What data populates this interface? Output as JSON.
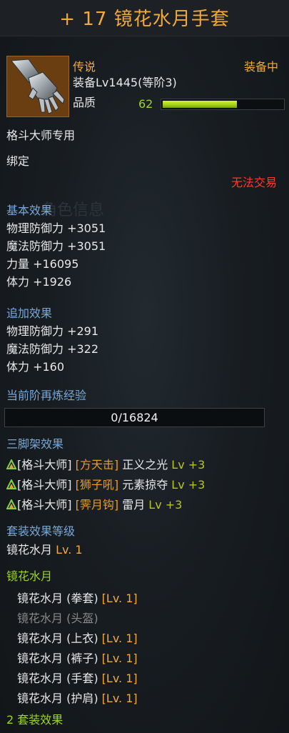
{
  "item": {
    "title": "+ 17 镜花水月手套",
    "rarity": "传说",
    "equipped": "装备中",
    "level": "装备Lv1445(等阶3)",
    "quality_label": "品质",
    "quality_value": "62",
    "quality_fraction": 0.62,
    "class_only": "格斗大师专用",
    "bound": "绑定",
    "no_trade": "无法交易",
    "icon": "gauntlet-icon"
  },
  "basic": {
    "heading": "基本效果",
    "lines": [
      "物理防御力 +3051",
      "魔法防御力 +3051",
      "力量 +16095",
      "体力 +1926"
    ]
  },
  "extra": {
    "heading": "追加效果",
    "lines": [
      "物理防御力 +291",
      "魔法防御力 +322",
      "体力 +160"
    ]
  },
  "refine": {
    "heading": "当前阶再炼经验",
    "value": "0/16824",
    "fraction": 0
  },
  "tripod": {
    "heading": "三脚架效果",
    "items": [
      {
        "cls": "[格斗大师]",
        "skill": "[方天击]",
        "effect": "正义之光",
        "lv": "Lv +3"
      },
      {
        "cls": "[格斗大师]",
        "skill": "[狮子吼]",
        "effect": "元素掠夺",
        "lv": "Lv +3"
      },
      {
        "cls": "[格斗大师]",
        "skill": "[霁月钩]",
        "effect": "雷月",
        "lv": "Lv +3"
      }
    ]
  },
  "set_level": {
    "heading": "套装效果等级",
    "name": "镜花水月",
    "lv": "Lv. 1"
  },
  "set": {
    "heading": "镜花水月",
    "pieces": [
      {
        "name": "镜花水月 (拳套)",
        "lv": "[Lv. 1]",
        "owned": true
      },
      {
        "name": "镜花水月 (头盔)",
        "lv": "",
        "owned": false
      },
      {
        "name": "镜花水月 (上衣)",
        "lv": "[Lv. 1]",
        "owned": true
      },
      {
        "name": "镜花水月 (裤子)",
        "lv": "[Lv. 1]",
        "owned": true
      },
      {
        "name": "镜花水月 (手套)",
        "lv": "[Lv. 1]",
        "owned": true
      },
      {
        "name": "镜花水月 (护肩)",
        "lv": "[Lv. 1]",
        "owned": true
      }
    ],
    "bonus_heading": "2 套装效果"
  },
  "colors": {
    "title": "#f0a93c",
    "heading": "#7aa7d6",
    "accent_green": "#9bd32e",
    "warning_red": "#ff3a2a"
  }
}
